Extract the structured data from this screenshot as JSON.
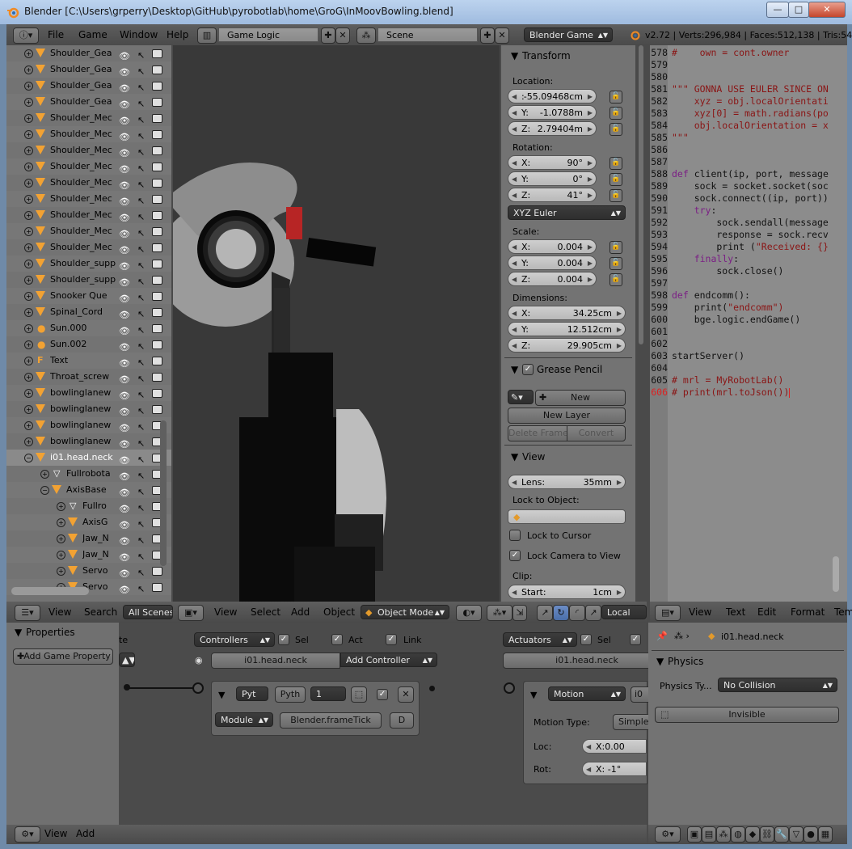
{
  "window": {
    "title": "Blender  [C:\\Users\\grperry\\Desktop\\GitHub\\pyrobotlab\\home\\GroG\\InMoovBowling.blend]",
    "min": "—",
    "max": "□",
    "close": "✕"
  },
  "info_header": {
    "menus": [
      "File",
      "Game",
      "Window",
      "Help"
    ],
    "screen_layout": "Game Logic",
    "scene": "Scene",
    "engine": "Blender Game",
    "stats": "v2.72 | Verts:296,984 | Faces:512,138 | Tris:54"
  },
  "outliner": {
    "rows": [
      {
        "name": "Shoulder_Gea",
        "icon": "mesh",
        "indent": 0
      },
      {
        "name": "Shoulder_Gea",
        "icon": "mesh",
        "indent": 0
      },
      {
        "name": "Shoulder_Gea",
        "icon": "mesh",
        "indent": 0
      },
      {
        "name": "Shoulder_Gea",
        "icon": "mesh",
        "indent": 0
      },
      {
        "name": "Shoulder_Mec",
        "icon": "mesh",
        "indent": 0
      },
      {
        "name": "Shoulder_Mec",
        "icon": "mesh",
        "indent": 0
      },
      {
        "name": "Shoulder_Mec",
        "icon": "mesh",
        "indent": 0
      },
      {
        "name": "Shoulder_Mec",
        "icon": "mesh",
        "indent": 0
      },
      {
        "name": "Shoulder_Mec",
        "icon": "mesh",
        "indent": 0
      },
      {
        "name": "Shoulder_Mec",
        "icon": "mesh",
        "indent": 0
      },
      {
        "name": "Shoulder_Mec",
        "icon": "mesh",
        "indent": 0
      },
      {
        "name": "Shoulder_Mec",
        "icon": "mesh",
        "indent": 0
      },
      {
        "name": "Shoulder_Mec",
        "icon": "mesh",
        "indent": 0
      },
      {
        "name": "Shoulder_supp",
        "icon": "mesh",
        "indent": 0
      },
      {
        "name": "Shoulder_supp",
        "icon": "mesh",
        "indent": 0
      },
      {
        "name": "Snooker Que",
        "icon": "mesh",
        "indent": 0
      },
      {
        "name": "Spinal_Cord",
        "icon": "mesh",
        "indent": 0
      },
      {
        "name": "Sun.000",
        "icon": "lamp",
        "indent": 0
      },
      {
        "name": "Sun.002",
        "icon": "lamp",
        "indent": 0
      },
      {
        "name": "Text",
        "icon": "text",
        "indent": 0
      },
      {
        "name": "Throat_screw",
        "icon": "mesh",
        "indent": 0
      },
      {
        "name": "bowlinglanew",
        "icon": "mesh",
        "indent": 0
      },
      {
        "name": "bowlinglanew",
        "icon": "mesh",
        "indent": 0
      },
      {
        "name": "bowlinglanew",
        "icon": "mesh",
        "indent": 0
      },
      {
        "name": "bowlinglanew",
        "icon": "mesh",
        "indent": 0
      },
      {
        "name": "i01.head.neck",
        "icon": "mesh",
        "indent": 0,
        "selected": true,
        "expanded": true
      },
      {
        "name": "Fullrobota",
        "icon": "modifier",
        "indent": 1
      },
      {
        "name": "AxisBase",
        "icon": "mesh",
        "indent": 1,
        "expanded": true
      },
      {
        "name": "Fullro",
        "icon": "modifier",
        "indent": 2
      },
      {
        "name": "AxisG",
        "icon": "mesh",
        "indent": 2
      },
      {
        "name": "Jaw_N",
        "icon": "mesh",
        "indent": 2
      },
      {
        "name": "Jaw_N",
        "icon": "mesh",
        "indent": 2
      },
      {
        "name": "Servo",
        "icon": "mesh",
        "indent": 2
      },
      {
        "name": "Servo",
        "icon": "mesh",
        "indent": 2
      }
    ]
  },
  "outliner_header": {
    "view": "View",
    "search": "Search",
    "filter": "All Scenes"
  },
  "viewport_header": {
    "menus": [
      "View",
      "Select",
      "Add",
      "Object"
    ],
    "mode": "Object Mode",
    "orientation": "Local"
  },
  "properties_panel": {
    "transform": {
      "title": "Transform",
      "location_label": "Location:",
      "location": [
        {
          "axis": ":",
          "value": "-55.09468cm"
        },
        {
          "axis": "Y:",
          "value": "-1.0788m"
        },
        {
          "axis": "Z:",
          "value": "2.79404m"
        }
      ],
      "rotation_label": "Rotation:",
      "rotation": [
        {
          "axis": "X:",
          "value": "90°"
        },
        {
          "axis": "Y:",
          "value": "0°"
        },
        {
          "axis": "Z:",
          "value": "41°"
        }
      ],
      "rotation_mode": "XYZ Euler",
      "scale_label": "Scale:",
      "scale": [
        {
          "axis": "X:",
          "value": "0.004"
        },
        {
          "axis": "Y:",
          "value": "0.004"
        },
        {
          "axis": "Z:",
          "value": "0.004"
        }
      ],
      "dimensions_label": "Dimensions:",
      "dimensions": [
        {
          "axis": "X:",
          "value": "34.25cm"
        },
        {
          "axis": "Y:",
          "value": "12.512cm"
        },
        {
          "axis": "Z:",
          "value": "29.905cm"
        }
      ]
    },
    "grease_pencil": {
      "title": "Grease Pencil",
      "new": "New",
      "new_layer": "New Layer",
      "delete_frame": "Delete Frame",
      "convert": "Convert"
    },
    "view": {
      "title": "View",
      "lens_label": "Lens:",
      "lens_value": "35mm",
      "lock_to_object": "Lock to Object:",
      "lock_to_cursor": "Lock to Cursor",
      "lock_camera": "Lock Camera to View",
      "clip": "Clip:",
      "clip_start_label": "Start:",
      "clip_start_value": "1cm"
    }
  },
  "text_editor": {
    "lines": [
      {
        "n": "578",
        "text": "#    own = cont.owner",
        "cls": "cm",
        "indent": 1
      },
      {
        "n": "579",
        "text": "",
        "cls": "",
        "indent": 0
      },
      {
        "n": "580",
        "text": "",
        "cls": "",
        "indent": 0
      },
      {
        "n": "581",
        "text": "\"\"\" GONNA USE EULER SINCE ON",
        "cls": "str",
        "indent": 0
      },
      {
        "n": "582",
        "text": "    xyz = obj.localOrientati",
        "cls": "str",
        "indent": 0
      },
      {
        "n": "583",
        "text": "    xyz[0] = math.radians(po",
        "cls": "str",
        "indent": 0
      },
      {
        "n": "584",
        "text": "    obj.localOrientation = x",
        "cls": "str",
        "indent": 0
      },
      {
        "n": "585",
        "text": "\"\"\"",
        "cls": "str",
        "indent": 0
      },
      {
        "n": "586",
        "text": "",
        "cls": "",
        "indent": 0
      },
      {
        "n": "587",
        "text": "",
        "cls": "",
        "indent": 0
      },
      {
        "n": "588",
        "text": "def client(ip, port, message",
        "cls": "def",
        "indent": 0
      },
      {
        "n": "589",
        "text": "    sock = socket.socket(soc",
        "cls": "",
        "indent": 0
      },
      {
        "n": "590",
        "text": "    sock.connect((ip, port))",
        "cls": "",
        "indent": 0
      },
      {
        "n": "591",
        "text": "    try:",
        "cls": "kwline",
        "indent": 0
      },
      {
        "n": "592",
        "text": "        sock.sendall(message",
        "cls": "",
        "indent": 0
      },
      {
        "n": "593",
        "text": "        response = sock.recv",
        "cls": "",
        "indent": 0
      },
      {
        "n": "594",
        "text": "        print (\"Received: {}",
        "cls": "print",
        "indent": 0
      },
      {
        "n": "595",
        "text": "    finally:",
        "cls": "kwline",
        "indent": 0
      },
      {
        "n": "596",
        "text": "        sock.close()",
        "cls": "",
        "indent": 0
      },
      {
        "n": "597",
        "text": "",
        "cls": "",
        "indent": 0
      },
      {
        "n": "598",
        "text": "def endcomm():",
        "cls": "def",
        "indent": 0
      },
      {
        "n": "599",
        "text": "    print(\"endcomm\")",
        "cls": "print",
        "indent": 0
      },
      {
        "n": "600",
        "text": "    bge.logic.endGame()",
        "cls": "",
        "indent": 0
      },
      {
        "n": "601",
        "text": "",
        "cls": "",
        "indent": 0
      },
      {
        "n": "602",
        "text": "",
        "cls": "",
        "indent": 0
      },
      {
        "n": "603",
        "text": "startServer()",
        "cls": "",
        "indent": 0
      },
      {
        "n": "604",
        "text": "",
        "cls": "",
        "indent": 0
      },
      {
        "n": "605",
        "text": "# mrl = MyRobotLab()",
        "cls": "cm",
        "indent": 0
      },
      {
        "n": "606",
        "text": "# print(mrl.toJson())",
        "cls": "cm",
        "indent": 0,
        "current": true
      }
    ],
    "header": {
      "menus": [
        "View",
        "Text",
        "Edit",
        "Format",
        "Tem"
      ]
    }
  },
  "logic_editor": {
    "properties_title": "Properties",
    "add_game_property": "Add Game Property",
    "sensors_partial": "te",
    "controllers": {
      "label": "Controllers",
      "sel": "Sel",
      "act": "Act",
      "link": "Link",
      "object": "i01.head.neck",
      "add": "Add Controller"
    },
    "controller_brick": {
      "type": "Pyt",
      "name": "Pyth",
      "state": "1",
      "mode": "Module",
      "module": "Blender.frameTick",
      "d": "D"
    },
    "actuators": {
      "label": "Actuators",
      "sel": "Sel",
      "object": "i01.head.neck"
    },
    "actuator_brick": {
      "type": "Motion",
      "name": "i0",
      "motion_type_label": "Motion Type:",
      "motion_type": "Simple",
      "loc_label": "Loc:",
      "loc_value": "X:0.00",
      "rot_label": "Rot:",
      "rot_value": "X:  -1°"
    },
    "footer": {
      "view": "View",
      "add": "Add"
    }
  },
  "props_editor": {
    "object": "i01.head.neck",
    "physics_title": "Physics",
    "physics_type_label": "Physics Ty...",
    "physics_type": "No Collision",
    "invisible": "Invisible"
  }
}
